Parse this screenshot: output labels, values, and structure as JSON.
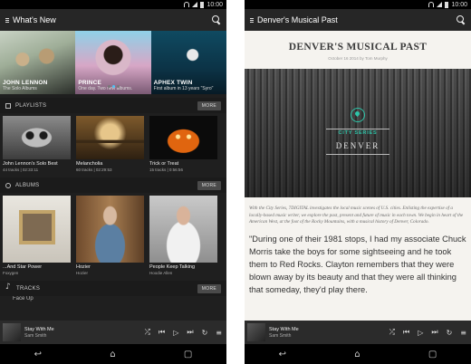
{
  "status": {
    "time": "10:00"
  },
  "left_screen": {
    "appbar_title": "What's New",
    "carousel": [
      {
        "title": "JOHN LENNON",
        "subtitle": "The Solo Albums"
      },
      {
        "title": "PRINCE",
        "subtitle": "One day. Two new albums."
      },
      {
        "title": "APHEX TWIN",
        "subtitle": "First album in 13 years \"Syro\""
      }
    ],
    "playlists": {
      "heading": "PLAYLISTS",
      "more": "MORE",
      "items": [
        {
          "title": "John Lennon's Solo Best",
          "sub": "44 tracks | 02:33:11"
        },
        {
          "title": "Melancholia",
          "sub": "60 tracks | 02:29:53"
        },
        {
          "title": "Trick or Treat",
          "sub": "15 tracks | 0:56:56"
        }
      ]
    },
    "albums": {
      "heading": "ALBUMS",
      "more": "MORE",
      "items": [
        {
          "title": "...And Star Power",
          "sub": "Foxygen"
        },
        {
          "title": "Hozier",
          "sub": "Hozier"
        },
        {
          "title": "People Keep Talking",
          "sub": "Hoodie Allen"
        }
      ]
    },
    "tracks": {
      "heading": "TRACKS",
      "more": "MORE",
      "peek": "Face Up"
    }
  },
  "now_playing": {
    "title": "Stay With Me",
    "artist": "Sam Smith"
  },
  "right_screen": {
    "appbar_title": "Denver's Musical Past",
    "headline": "DENVER'S MUSICAL PAST",
    "byline": "October 16 2014 by Tom Murphy",
    "hero_label": "CITY SERIES",
    "hero_city": "DENVER",
    "intro": "With the City Series, 7DIGITAL investigates the local music scenes of U.S. cities. Enlisting the expertise of a locally-based music writer, we explore the past, present and future of music in each town. We begin in heart of the American West, at the foot of the Rocky Mountains, with a musical history of Denver, Colorado.",
    "quote": "\"During one of their 1981 stops, I had my associate Chuck Morris take the boys for some sightseeing and he took them to Red Rocks. Clayton remembers that they were blown away by its beauty and that they were all thinking that someday, they'd play there."
  },
  "colors": {
    "accent": "#2ec4a8",
    "carousel_dot_active": "#4fc3f7",
    "dark_bg": "#1f1f1f",
    "light_bg": "#f5f3ef"
  },
  "icons": {
    "menu": "menu-icon",
    "search": "search-icon",
    "shuffle": "shuffle-icon",
    "prev": "skip-previous-icon",
    "play": "play-icon",
    "next": "skip-next-icon",
    "repeat": "repeat-icon",
    "queue": "queue-icon",
    "back": "back-icon",
    "home": "home-icon",
    "recents": "recents-icon"
  }
}
